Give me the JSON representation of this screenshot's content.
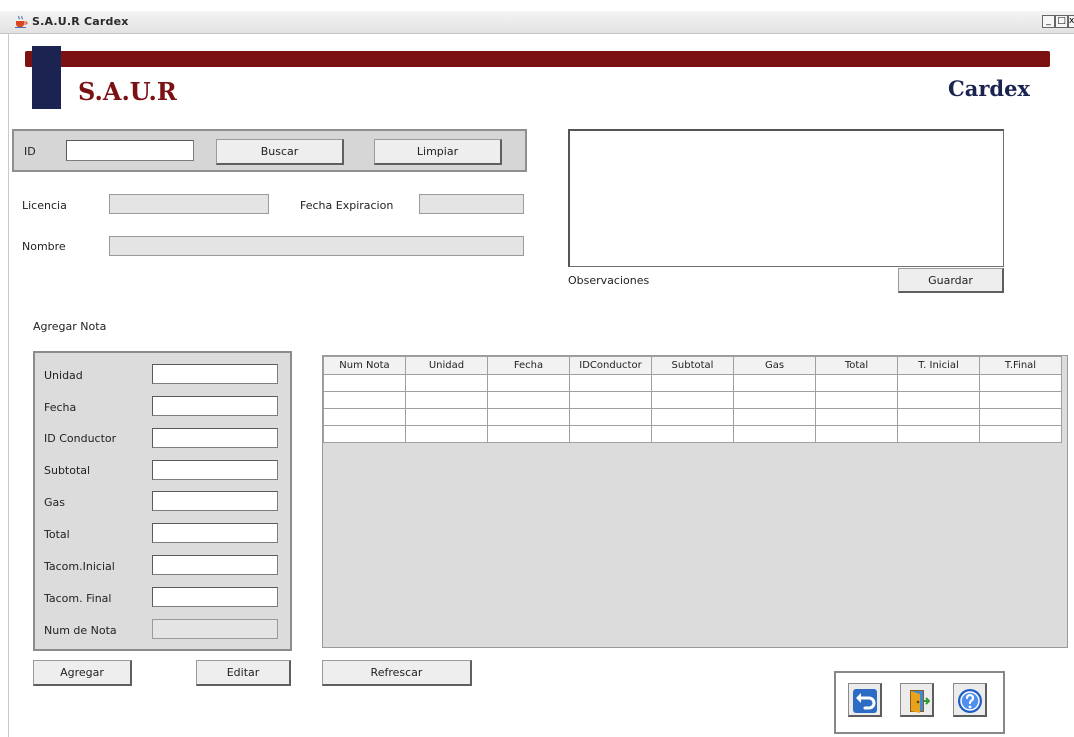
{
  "window": {
    "title": "S.A.U.R    Cardex",
    "minimize": "_",
    "maximize": "□",
    "close": "x"
  },
  "header": {
    "brand": "S.A.U.R",
    "module": "Cardex"
  },
  "search": {
    "id_label": "ID",
    "id_value": "",
    "buscar_label": "Buscar",
    "limpiar_label": "Limpiar"
  },
  "driver": {
    "licencia_label": "Licencia",
    "licencia_value": "",
    "fecha_expiracion_label": "Fecha Expiracion",
    "fecha_expiracion_value": "",
    "nombre_label": "Nombre",
    "nombre_value": ""
  },
  "observaciones": {
    "label": "Observaciones",
    "value": "",
    "guardar_label": "Guardar"
  },
  "nota": {
    "section_label": "Agregar Nota",
    "fields": [
      {
        "label": "Unidad",
        "value": ""
      },
      {
        "label": "Fecha",
        "value": ""
      },
      {
        "label": "ID Conductor",
        "value": ""
      },
      {
        "label": "Subtotal",
        "value": ""
      },
      {
        "label": "Gas",
        "value": ""
      },
      {
        "label": "Total",
        "value": ""
      },
      {
        "label": "Tacom.Inicial",
        "value": ""
      },
      {
        "label": "Tacom. Final",
        "value": ""
      },
      {
        "label": "Num de Nota",
        "value": ""
      }
    ],
    "agregar_label": "Agregar",
    "editar_label": "Editar"
  },
  "table": {
    "columns": [
      "Num Nota",
      "Unidad",
      "Fecha",
      "IDConductor",
      "Subtotal",
      "Gas",
      "Total",
      "T. Inicial",
      "T.Final"
    ],
    "rows": [
      [
        "",
        "",
        "",
        "",
        "",
        "",
        "",
        "",
        ""
      ],
      [
        "",
        "",
        "",
        "",
        "",
        "",
        "",
        "",
        ""
      ],
      [
        "",
        "",
        "",
        "",
        "",
        "",
        "",
        "",
        ""
      ],
      [
        "",
        "",
        "",
        "",
        "",
        "",
        "",
        "",
        ""
      ]
    ],
    "refrescar_label": "Refrescar"
  },
  "toolbar": {
    "icons": [
      "undo-icon",
      "exit-door-icon",
      "help-icon"
    ]
  },
  "colors": {
    "brand_red": "#7b1113",
    "brand_navy": "#1b2450",
    "panel_gray": "#dcdcdc"
  }
}
